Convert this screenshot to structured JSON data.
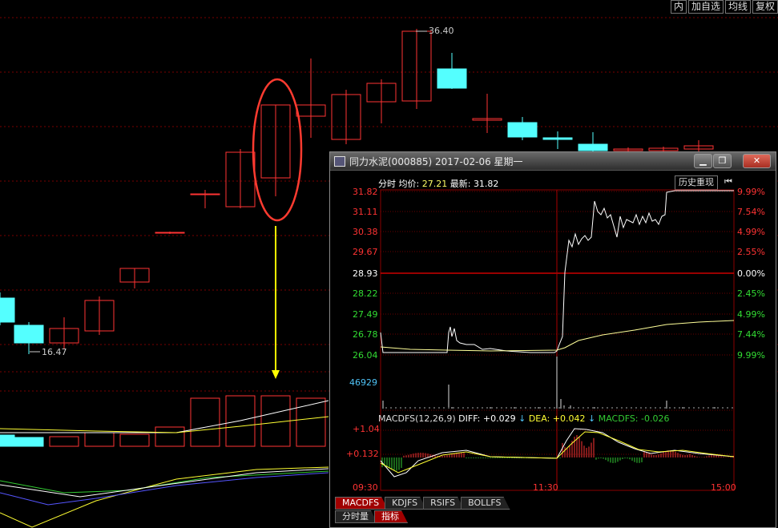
{
  "toolbar": {
    "items": [
      "内",
      "加自选",
      "均线",
      "复权"
    ]
  },
  "kline": {
    "high_label": "36.40",
    "low_label": "16.47"
  },
  "popup": {
    "title": "同力水泥(000885) 2017-02-06 星期一",
    "header": {
      "label": "分时",
      "avg_label": "均价:",
      "avg_value": "27.21",
      "last_label": "最新:",
      "last_value": "31.82"
    },
    "replay_button": "历史重现",
    "price_axis": [
      "31.82",
      "31.11",
      "30.38",
      "29.67",
      "28.93",
      "28.22",
      "27.49",
      "26.78",
      "26.04"
    ],
    "pct_axis": [
      "9.99%",
      "7.54%",
      "4.99%",
      "2.55%",
      "0.00%",
      "2.45%",
      "4.99%",
      "7.44%",
      "9.99%"
    ],
    "volume_max": "46929",
    "macd": {
      "title": "MACDFS(12,26,9)",
      "diff": "DIFF: +0.029",
      "dea": "DEA: +0.042",
      "macdfs": "MACDFS: -0.026",
      "axis_top": "+1.04",
      "axis_mid": "+0.132"
    },
    "time_axis": [
      "09:30",
      "11:30",
      "15:00"
    ],
    "indicator_tabs": [
      "MACDFS",
      "KDJFS",
      "RSIFS",
      "BOLLFS"
    ],
    "view_tabs": [
      "分时量",
      "指标"
    ]
  },
  "colors": {
    "up": "#ff3333",
    "down": "#54ffff",
    "grid": "#7a0000",
    "highlight": "#ff3b30",
    "arrow": "#ffff00"
  }
}
